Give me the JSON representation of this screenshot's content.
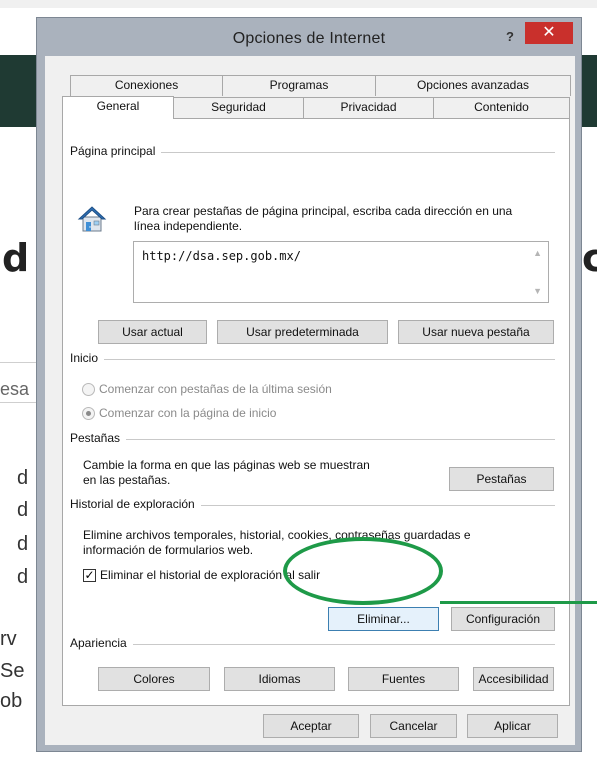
{
  "background": {
    "big_letter_left": "d",
    "big_letter_right": "c",
    "side_fragment": "esa",
    "left_letters": [
      "d",
      "d",
      "d",
      "d"
    ],
    "lower_fragments": [
      "rv",
      "Se",
      "ob"
    ]
  },
  "window": {
    "title": "Opciones de Internet",
    "help_label": "?",
    "close_label": "✕"
  },
  "tabs": {
    "row1": [
      "Conexiones",
      "Programas",
      "Opciones avanzadas"
    ],
    "row2": [
      "General",
      "Seguridad",
      "Privacidad",
      "Contenido"
    ],
    "active": "General"
  },
  "home_page": {
    "group_label": "Página principal",
    "instructions": "Para crear pestañas de página principal, escriba cada dirección en una línea independiente.",
    "url": "http://dsa.sep.gob.mx/",
    "buttons": [
      "Usar actual",
      "Usar predeterminada",
      "Usar nueva pestaña"
    ]
  },
  "startup": {
    "group_label": "Inicio",
    "option1": "Comenzar con pestañas de la última sesión",
    "option2": "Comenzar con la página de inicio",
    "selected": "Comenzar con la página de inicio"
  },
  "tabs_group": {
    "group_label": "Pestañas",
    "description": "Cambie la forma en que las páginas web se muestran en las pestañas.",
    "button": "Pestañas"
  },
  "history": {
    "group_label": "Historial de exploración",
    "description": "Elimine archivos temporales, historial, cookies, contraseñas guardadas e información de formularios web.",
    "checkbox_label": "Eliminar el historial de exploración al salir",
    "checkbox_checked": true,
    "delete_button": "Eliminar...",
    "settings_button": "Configuración"
  },
  "appearance": {
    "group_label": "Apariencia",
    "buttons": [
      "Colores",
      "Idiomas",
      "Fuentes",
      "Accesibilidad"
    ]
  },
  "footer": {
    "ok": "Aceptar",
    "cancel": "Cancelar",
    "apply": "Aplicar"
  },
  "colors": {
    "annotation": "#1e9a48",
    "close_button": "#c9302c",
    "page_header": "#1f3a33"
  }
}
